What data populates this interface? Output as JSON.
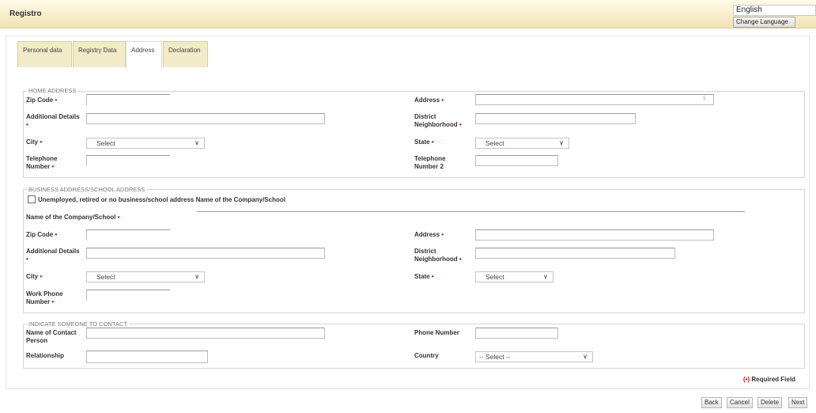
{
  "header": {
    "title": "Registro",
    "language_value": "English",
    "change_language_label": "Change Language"
  },
  "tabs": [
    {
      "label": "Personal data"
    },
    {
      "label": "Registry Data"
    },
    {
      "label": "Address"
    },
    {
      "label": "Declaration"
    }
  ],
  "home": {
    "legend": "HOME ADDRESS",
    "zip_label": "Zip Code",
    "address_label": "Address",
    "additional_label": "Additional Details",
    "district_label1": "District",
    "district_label2": "Neighborhood",
    "city_label": "City",
    "city_value": "Select",
    "state_label": "State",
    "state_value": "Select",
    "phone_label1": "Telephone",
    "phone_label2": "Number",
    "phone2_label1": "Telephone",
    "phone2_label2": "Number 2"
  },
  "business": {
    "legend": "BUSINESS ADDRESS/SCHOOL ADDRESS",
    "unemployed_label": "Unemployed, retired or no business/school address Name of the Company/School",
    "company_label": "Name of the Company/School",
    "zip_label": "Zip Code",
    "address_label": "Address",
    "additional_label": "Additional Details",
    "district_label1": "District",
    "district_label2": "Neighborhood",
    "city_label": "City",
    "city_value": "Select",
    "state_label": "State",
    "state_value": "Select",
    "work_phone_label1": "Work Phone",
    "work_phone_label2": "Number"
  },
  "contact": {
    "legend": "INDICATE SOMEONE TO CONTACT",
    "name_label1": "Name of Contact",
    "name_label2": "Person",
    "phone_label": "Phone Number",
    "relationship_label": "Relationship",
    "country_label": "Country",
    "country_value": "-- Select --"
  },
  "footer": {
    "required_marker": "(•)",
    "required_text": "Required Field",
    "back_label": "Back",
    "cancel_label": "Cancel",
    "delete_label": "Delete",
    "next_label": "Next"
  },
  "icons": {
    "required_star": "•",
    "chevron": "∨",
    "key": "♀"
  },
  "colors": {
    "header_top": "#fffbea",
    "header_bottom": "#f1e2b4",
    "tab_bg": "#f2ebc8",
    "required": "#d40000"
  }
}
